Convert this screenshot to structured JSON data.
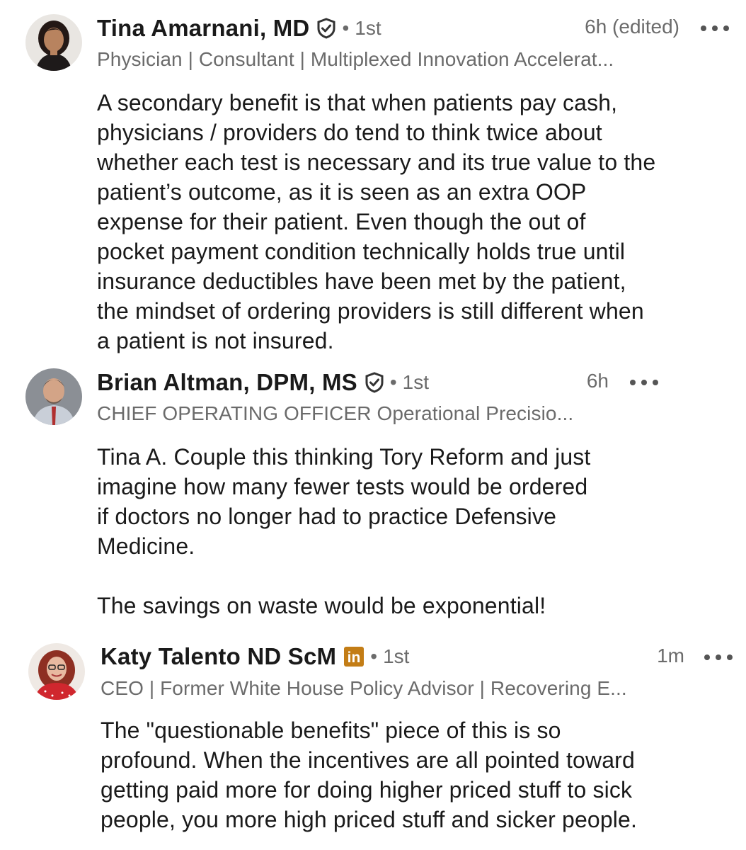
{
  "comments": [
    {
      "author": "Tina Amarnani, MD",
      "badge": "verified-shield-icon",
      "separator": "•",
      "degree": "1st",
      "time": "6h (edited)",
      "headline": "Physician | Consultant | Multiplexed Innovation Accelerat...",
      "text": "A secondary benefit is that when patients pay cash,\nphysicians / providers do tend to think twice about\nwhether each test is necessary and its true value to the\npatient’s outcome, as it is seen as an extra OOP\nexpense for their patient.  Even though the out of\npocket payment condition technically holds true until\ninsurance deductibles have been met by the patient,\nthe mindset of ordering providers is still different when\na patient is not insured."
    },
    {
      "author": "Brian Altman, DPM, MS",
      "badge": "verified-shield-icon",
      "separator": "•",
      "degree": "1st",
      "time": "6h",
      "headline": "CHIEF OPERATING OFFICER Operational Precisio...",
      "text": "Tina A. Couple this thinking Tory Reform and just\nimagine how many fewer tests would be ordered\nif doctors no longer had to practice Defensive\nMedicine.\n\nThe savings on waste would be exponential!"
    },
    {
      "author": "Katy Talento ND ScM",
      "badge": "linkedin-premium-icon",
      "badge_text": "in",
      "separator": "•",
      "degree": "1st",
      "time": "1m",
      "headline": "CEO | Former White House Policy Advisor | Recovering E...",
      "text": "The \"questionable benefits\" piece of this is so\nprofound. When the incentives are all pointed toward\ngetting paid more for doing higher priced stuff to sick\npeople, you more high priced stuff and sicker people."
    }
  ],
  "colors": {
    "name": "#1a1a1a",
    "meta": "#6b6b6b",
    "premium_badge": "#c37d16"
  }
}
